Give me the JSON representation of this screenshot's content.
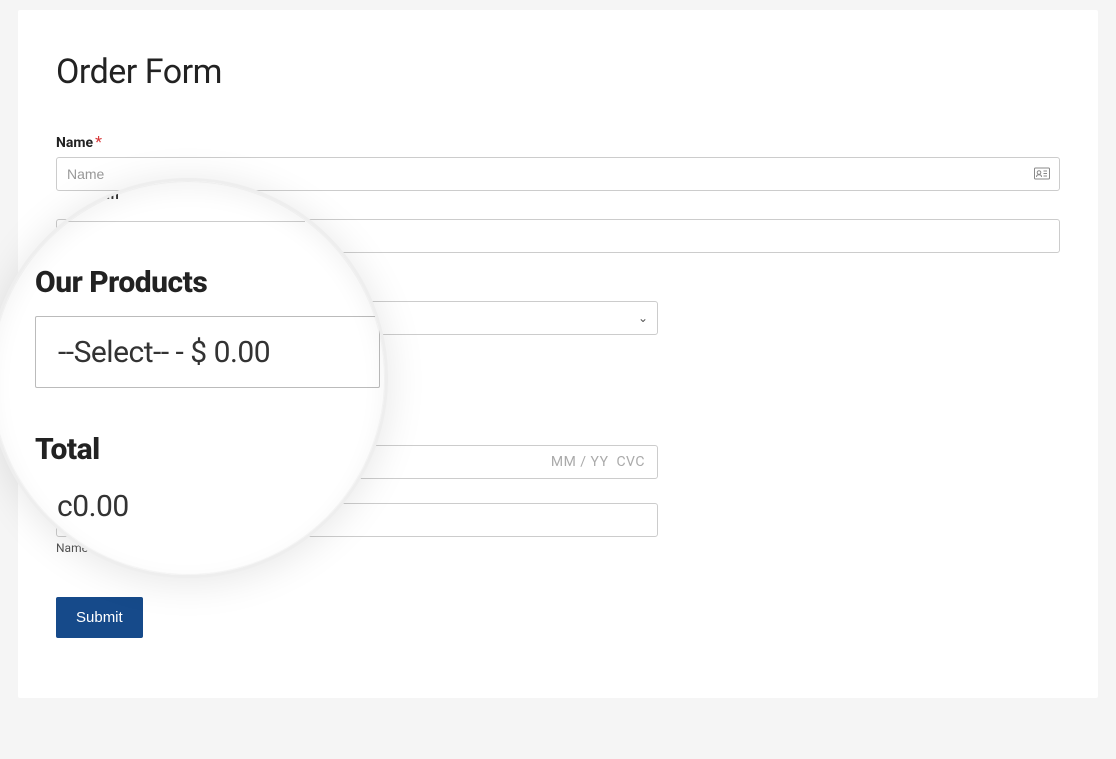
{
  "title": "Order Form",
  "fields": {
    "name": {
      "label": "Name",
      "required_marker": "*",
      "placeholder": "Name"
    },
    "email": {
      "partial_visible_label": "ail"
    },
    "products": {
      "heading": "Our Products",
      "selected_option": "--Select-- - $ 0.00",
      "caret": "⌄"
    },
    "total": {
      "heading": "Total",
      "value": "0.00",
      "masked_prefix": "c"
    },
    "card": {
      "number_placeholder": "",
      "expiry_placeholder": "MM / YY",
      "cvc_placeholder": "CVC",
      "name_on_card_caption": "Name on Card"
    }
  },
  "submit": {
    "label": "Submit"
  },
  "icons": {
    "card_suggest": "contact-card-icon"
  }
}
